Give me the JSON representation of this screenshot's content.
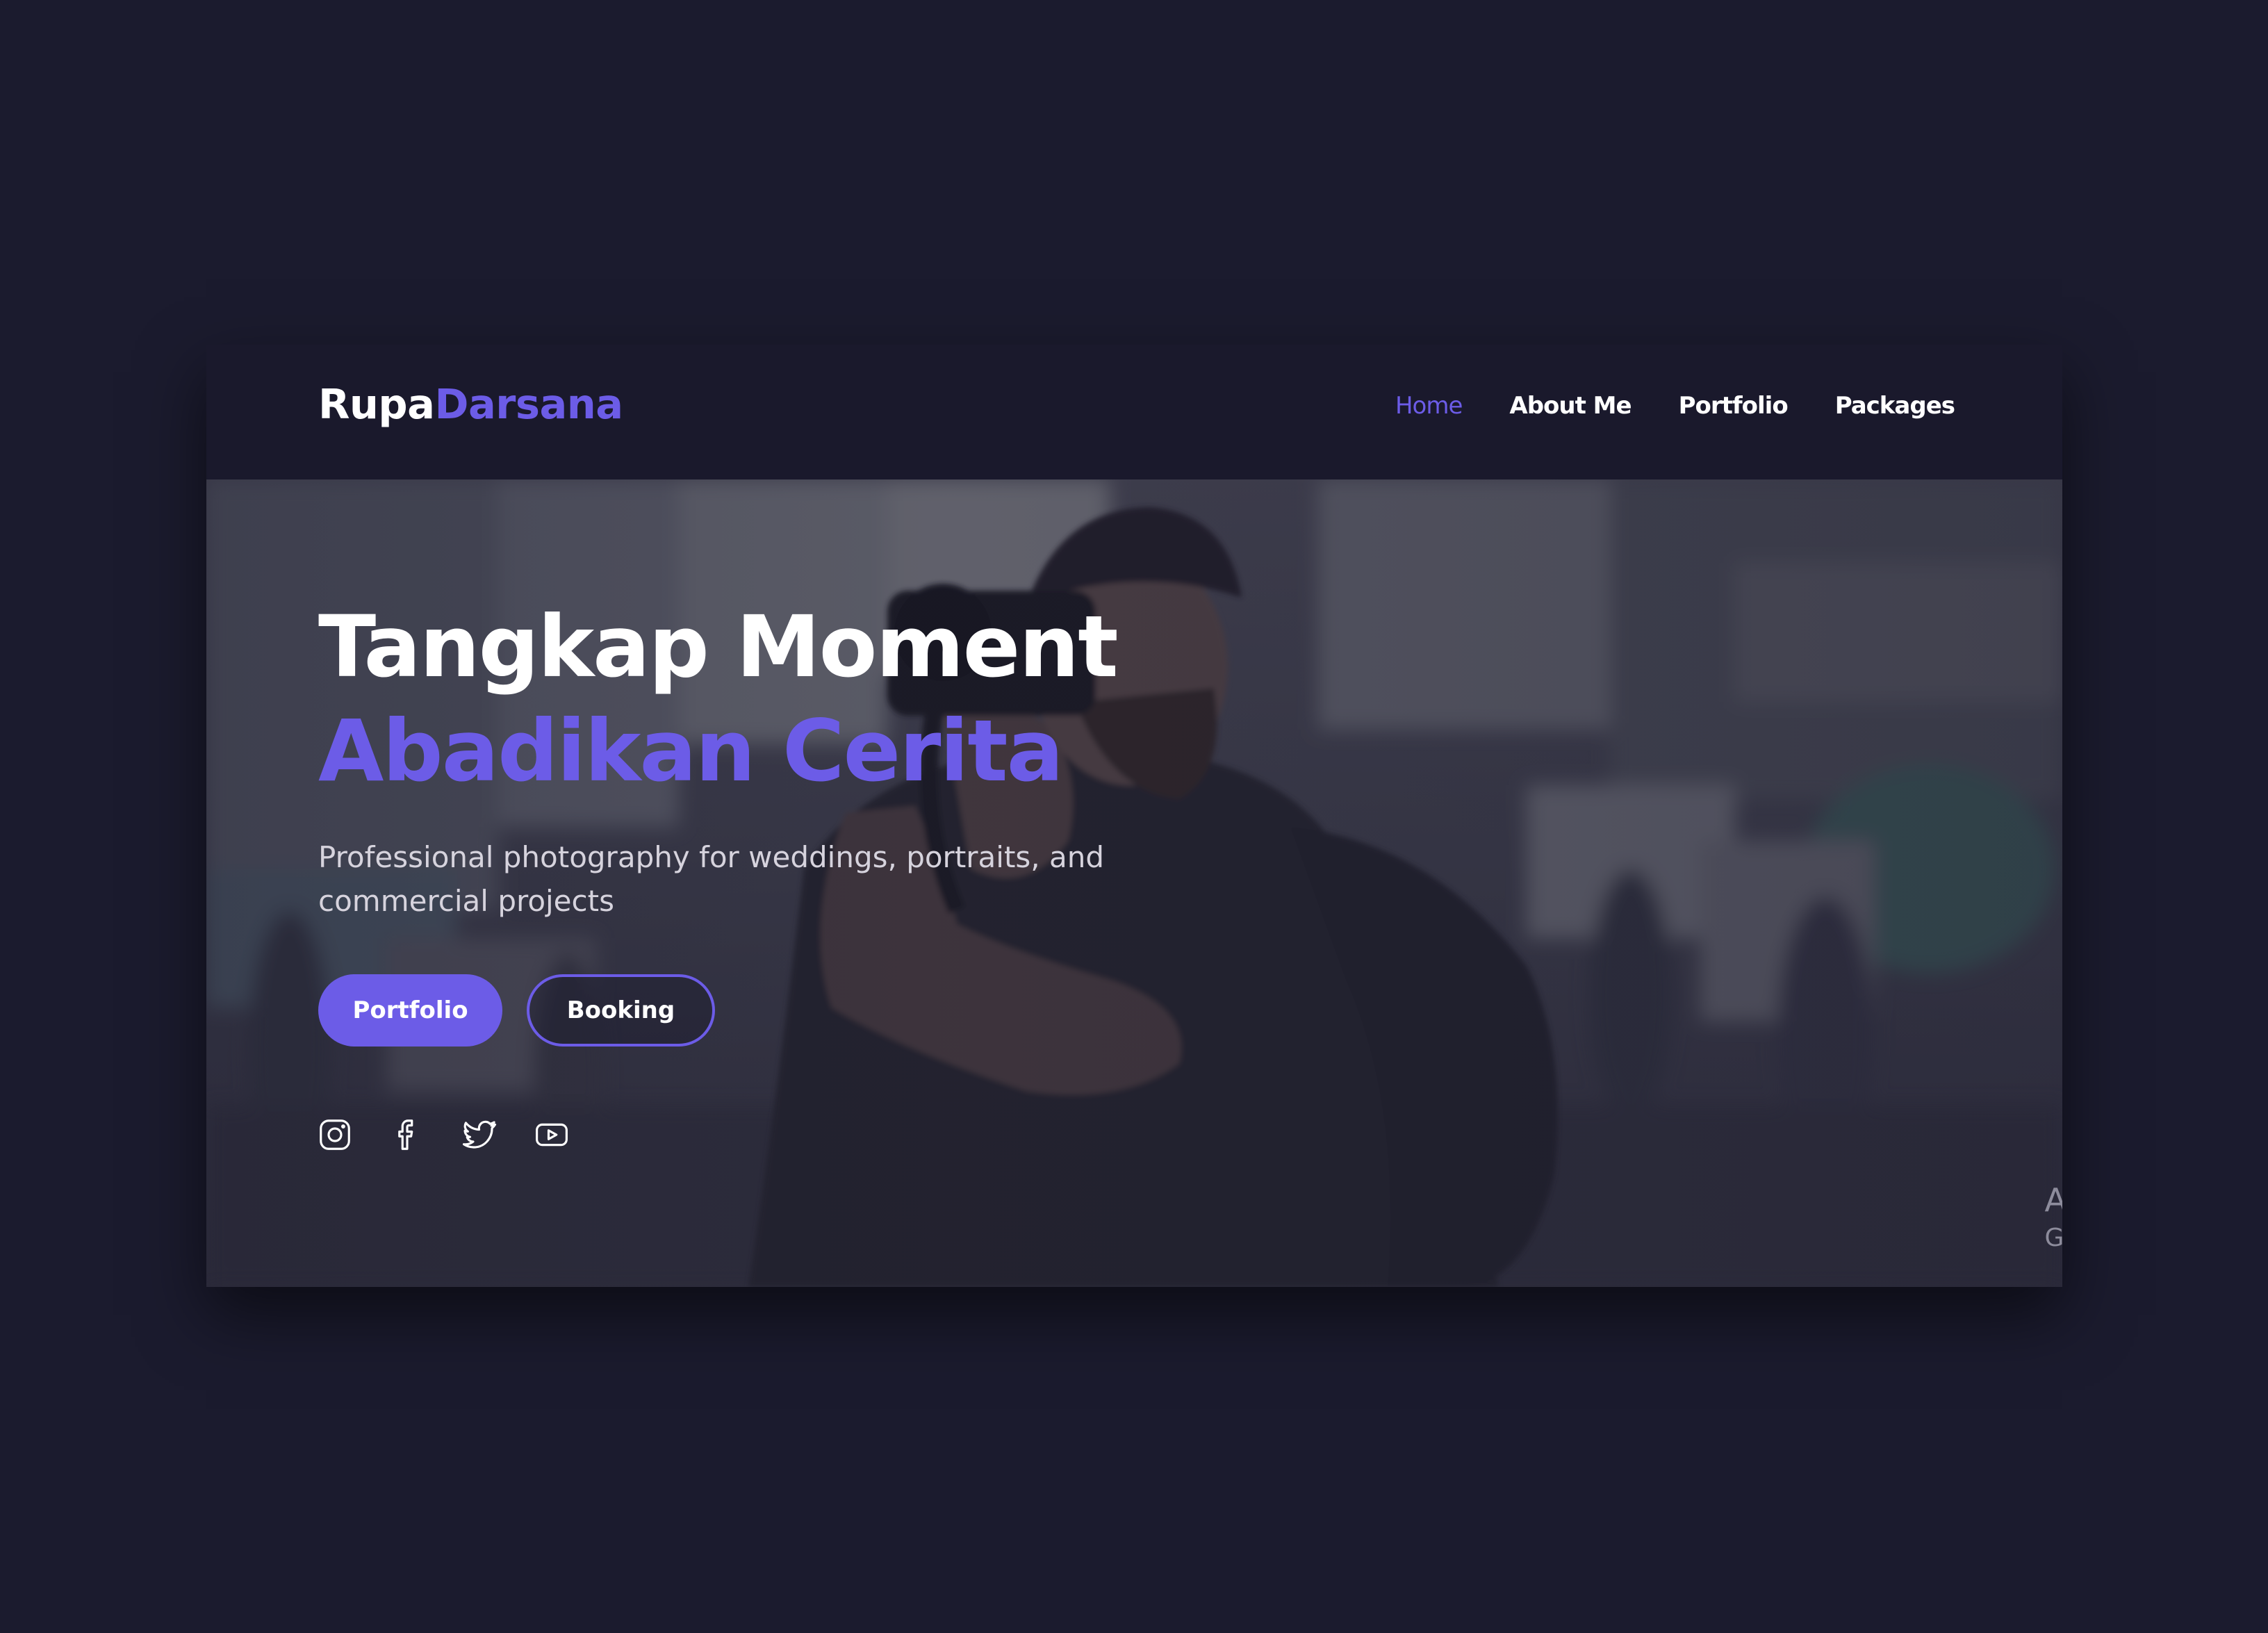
{
  "brand": {
    "part1": "Rupa",
    "part2": "Darsana",
    "accent": "#6c5ce7"
  },
  "nav": {
    "items": [
      {
        "label": "Home",
        "active": true
      },
      {
        "label": "About Me",
        "active": false
      },
      {
        "label": "Portfolio",
        "active": false
      },
      {
        "label": "Packages",
        "active": false
      }
    ]
  },
  "hero": {
    "title_line1": "Tangkap Moment",
    "title_line2": "Abadikan Cerita",
    "subtitle": "Professional photography for weddings, portraits, and commercial projects",
    "primary_button": "Portfolio",
    "secondary_button": "Booking",
    "socials": [
      "instagram-icon",
      "facebook-icon",
      "twitter-icon",
      "youtube-icon"
    ]
  },
  "corner": {
    "line1": "A",
    "line2": "G"
  },
  "colors": {
    "background": "#1b1b2e",
    "panel": "#1a192c",
    "accent": "#6c5ce7",
    "text": "#ffffff",
    "muted": "#d6d3dd"
  }
}
